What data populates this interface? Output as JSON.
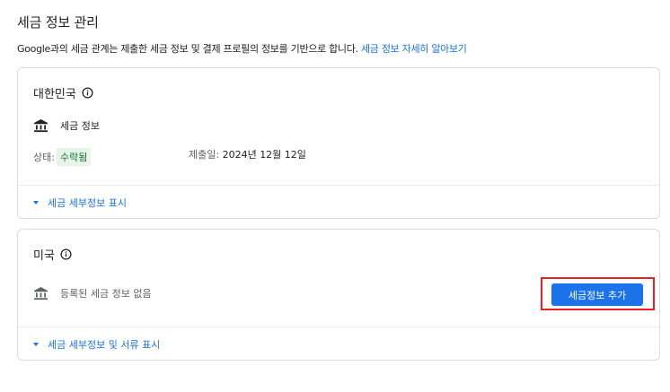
{
  "page": {
    "title": "세금 정보 관리",
    "description": "Google과의 세금 관계는 제출한 세금 정보 및 결제 프로필의 정보를 기반으로 합니다.",
    "learn_more": "세금 정보 자세히 알아보기"
  },
  "cards": [
    {
      "country": "대한민국",
      "tax_info_label": "세금 정보",
      "status_label": "상태:",
      "status_value": "수락됨",
      "submitted_label": "제출일:",
      "submitted_date": "2024년 12월 12일",
      "expand_label": "세금 세부정보 표시"
    },
    {
      "country": "미국",
      "empty_label": "등록된 세금 정보 없음",
      "add_button": "세금정보 추가",
      "expand_label": "세금 세부정보 및 서류 표시"
    }
  ],
  "colors": {
    "accent": "#1a73e8",
    "status_bg": "#e6f4ea",
    "status_fg": "#137333",
    "highlight": "#e8202a"
  },
  "icons": [
    "info-icon",
    "bank-icon",
    "triangle-down-icon"
  ]
}
